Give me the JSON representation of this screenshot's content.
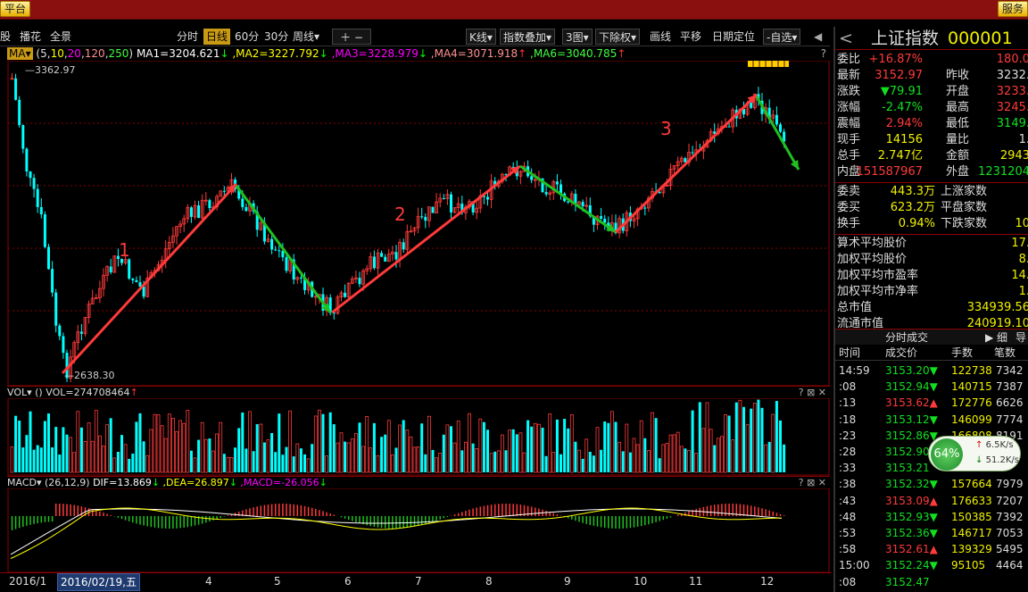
{
  "titlebar": {
    "left_button": "平台",
    "right_button": "服务"
  },
  "toolbar": {
    "left_items": [
      "股",
      "播花",
      "全景"
    ],
    "period_tabs": [
      "分时",
      "日线",
      "60分",
      "30分",
      "周线▾"
    ],
    "active_period": "日线",
    "right_items": [
      "K线▾",
      "指数叠加▾",
      "3图▾",
      "下除权▾",
      "画线",
      "平移",
      "日期定位",
      "-自选▾"
    ]
  },
  "ma_line": {
    "label": "MA▾",
    "params": "(5,10,20,120,250)",
    "ma1": "MA1=3204.621",
    "ma2": ",MA2=3227.792",
    "ma3": ",MA3=3228.979",
    "ma4": ",MA4=3071.918",
    "ma6": ",MA6=3040.785",
    "help": "?"
  },
  "colors": {
    "up": "#ff3a3a",
    "down": "#00ffff",
    "ma1": "#ffffff",
    "ma2": "#ffff00",
    "ma3": "#ff00ff",
    "ma4": "#ff9090",
    "ma6": "#40ff40",
    "trend_up": "#ff3a3a",
    "trend_down": "#20c020",
    "grid": "#8b0000"
  },
  "price_panel": {
    "high_label": "3362.97",
    "low_label": "2638.30",
    "annotation_1": "1",
    "annotation_2": "2",
    "annotation_3": "3"
  },
  "vol_panel": {
    "label": "VOL▾",
    "paren": "()",
    "value": "VOL=274708464",
    "help": "? ⊠ ✕"
  },
  "macd_panel": {
    "label": "MACD▾",
    "params": "(26,12,9)",
    "dif": "DIF=13.869",
    "dea": ",DEA=26.897",
    "macd": ",MACD=-26.056",
    "help": "? ⊠ ✕"
  },
  "x_axis": {
    "labels": [
      "2016/1",
      "2016/02/19,五",
      "4",
      "5",
      "6",
      "7",
      "8",
      "9",
      "10",
      "11",
      "12"
    ],
    "selected": "2016/02/19,五"
  },
  "right_panel": {
    "title": "上证指数",
    "code": "000001",
    "rows": [
      {
        "l": "委比",
        "v": "+16.87%",
        "l2": "",
        "v2": "180.0"
      },
      {
        "l": "最新",
        "v": "3152.97",
        "l2": "昨收",
        "v2": "3232."
      },
      {
        "l": "涨跌",
        "v": "▼79.91",
        "l2": "开盘",
        "v2": "3233."
      },
      {
        "l": "涨幅",
        "v": "-2.47%",
        "l2": "最高",
        "v2": "3245."
      },
      {
        "l": "震幅",
        "v": "2.94%",
        "l2": "最低",
        "v2": "3149."
      },
      {
        "l": "现手",
        "v": "14156",
        "l2": "量比",
        "v2": "1."
      },
      {
        "l": "总手",
        "v": "2.747亿",
        "l2": "金额",
        "v2": "2943"
      },
      {
        "l": "内盘",
        "v": "151587967",
        "l2": "外盘",
        "v2": "1231204"
      }
    ],
    "rows2": [
      {
        "l": "委卖",
        "v": "443.3万",
        "l2": "上涨家数",
        "v2": ""
      },
      {
        "l": "委买",
        "v": "623.2万",
        "l2": "平盘家数",
        "v2": ""
      },
      {
        "l": "换手",
        "v": "0.94%",
        "l2": "下跌家数",
        "v2": "10"
      }
    ],
    "stats": [
      {
        "l": "算术平均股价",
        "v": "17."
      },
      {
        "l": "加权平均股价",
        "v": "8."
      },
      {
        "l": "加权平均市盈率",
        "v": "14."
      },
      {
        "l": "加权平均市净率",
        "v": "1."
      },
      {
        "l": "总市值",
        "v": "334939.56"
      },
      {
        "l": "流通市值",
        "v": "240919.10"
      }
    ],
    "trades_tab": "分时成交",
    "trades_tab2": "▶ 细",
    "trades_tab3": "导",
    "trade_headers": [
      "时间",
      "成交价",
      "手数",
      "笔数"
    ],
    "trades": [
      {
        "t": "14:59",
        "p": "3153.20▼",
        "v": "122738",
        "n": "7342"
      },
      {
        "t": ":08",
        "p": "3152.94▼",
        "v": "140715",
        "n": "7387"
      },
      {
        "t": ":13",
        "p": "3153.62▲",
        "v": "172776",
        "n": "6626"
      },
      {
        "t": ":18",
        "p": "3153.12▼",
        "v": "146099",
        "n": "7774"
      },
      {
        "t": ":23",
        "p": "3152.86▼",
        "v": "166808",
        "n": "8191"
      },
      {
        "t": ":28",
        "p": "3152.90",
        "v": "",
        "n": ""
      },
      {
        "t": ":33",
        "p": "3153.21",
        "v": "",
        "n": ""
      },
      {
        "t": ":38",
        "p": "3152.32▼",
        "v": "157664",
        "n": "7979"
      },
      {
        "t": ":43",
        "p": "3153.09▲",
        "v": "176633",
        "n": "7207"
      },
      {
        "t": ":48",
        "p": "3152.93▼",
        "v": "150385",
        "n": "7392"
      },
      {
        "t": ":53",
        "p": "3152.36▼",
        "v": "146717",
        "n": "7053"
      },
      {
        "t": ":58",
        "p": "3152.61▲",
        "v": "139329",
        "n": "5495"
      },
      {
        "t": "15:00",
        "p": "3152.24▼",
        "v": "95105",
        "n": "4464"
      },
      {
        "t": ":08",
        "p": "3152.47",
        "v": "",
        "n": ""
      }
    ]
  },
  "net_widget": {
    "percent": "64%",
    "up": "6.5K/s",
    "down": "51.2K/s"
  }
}
